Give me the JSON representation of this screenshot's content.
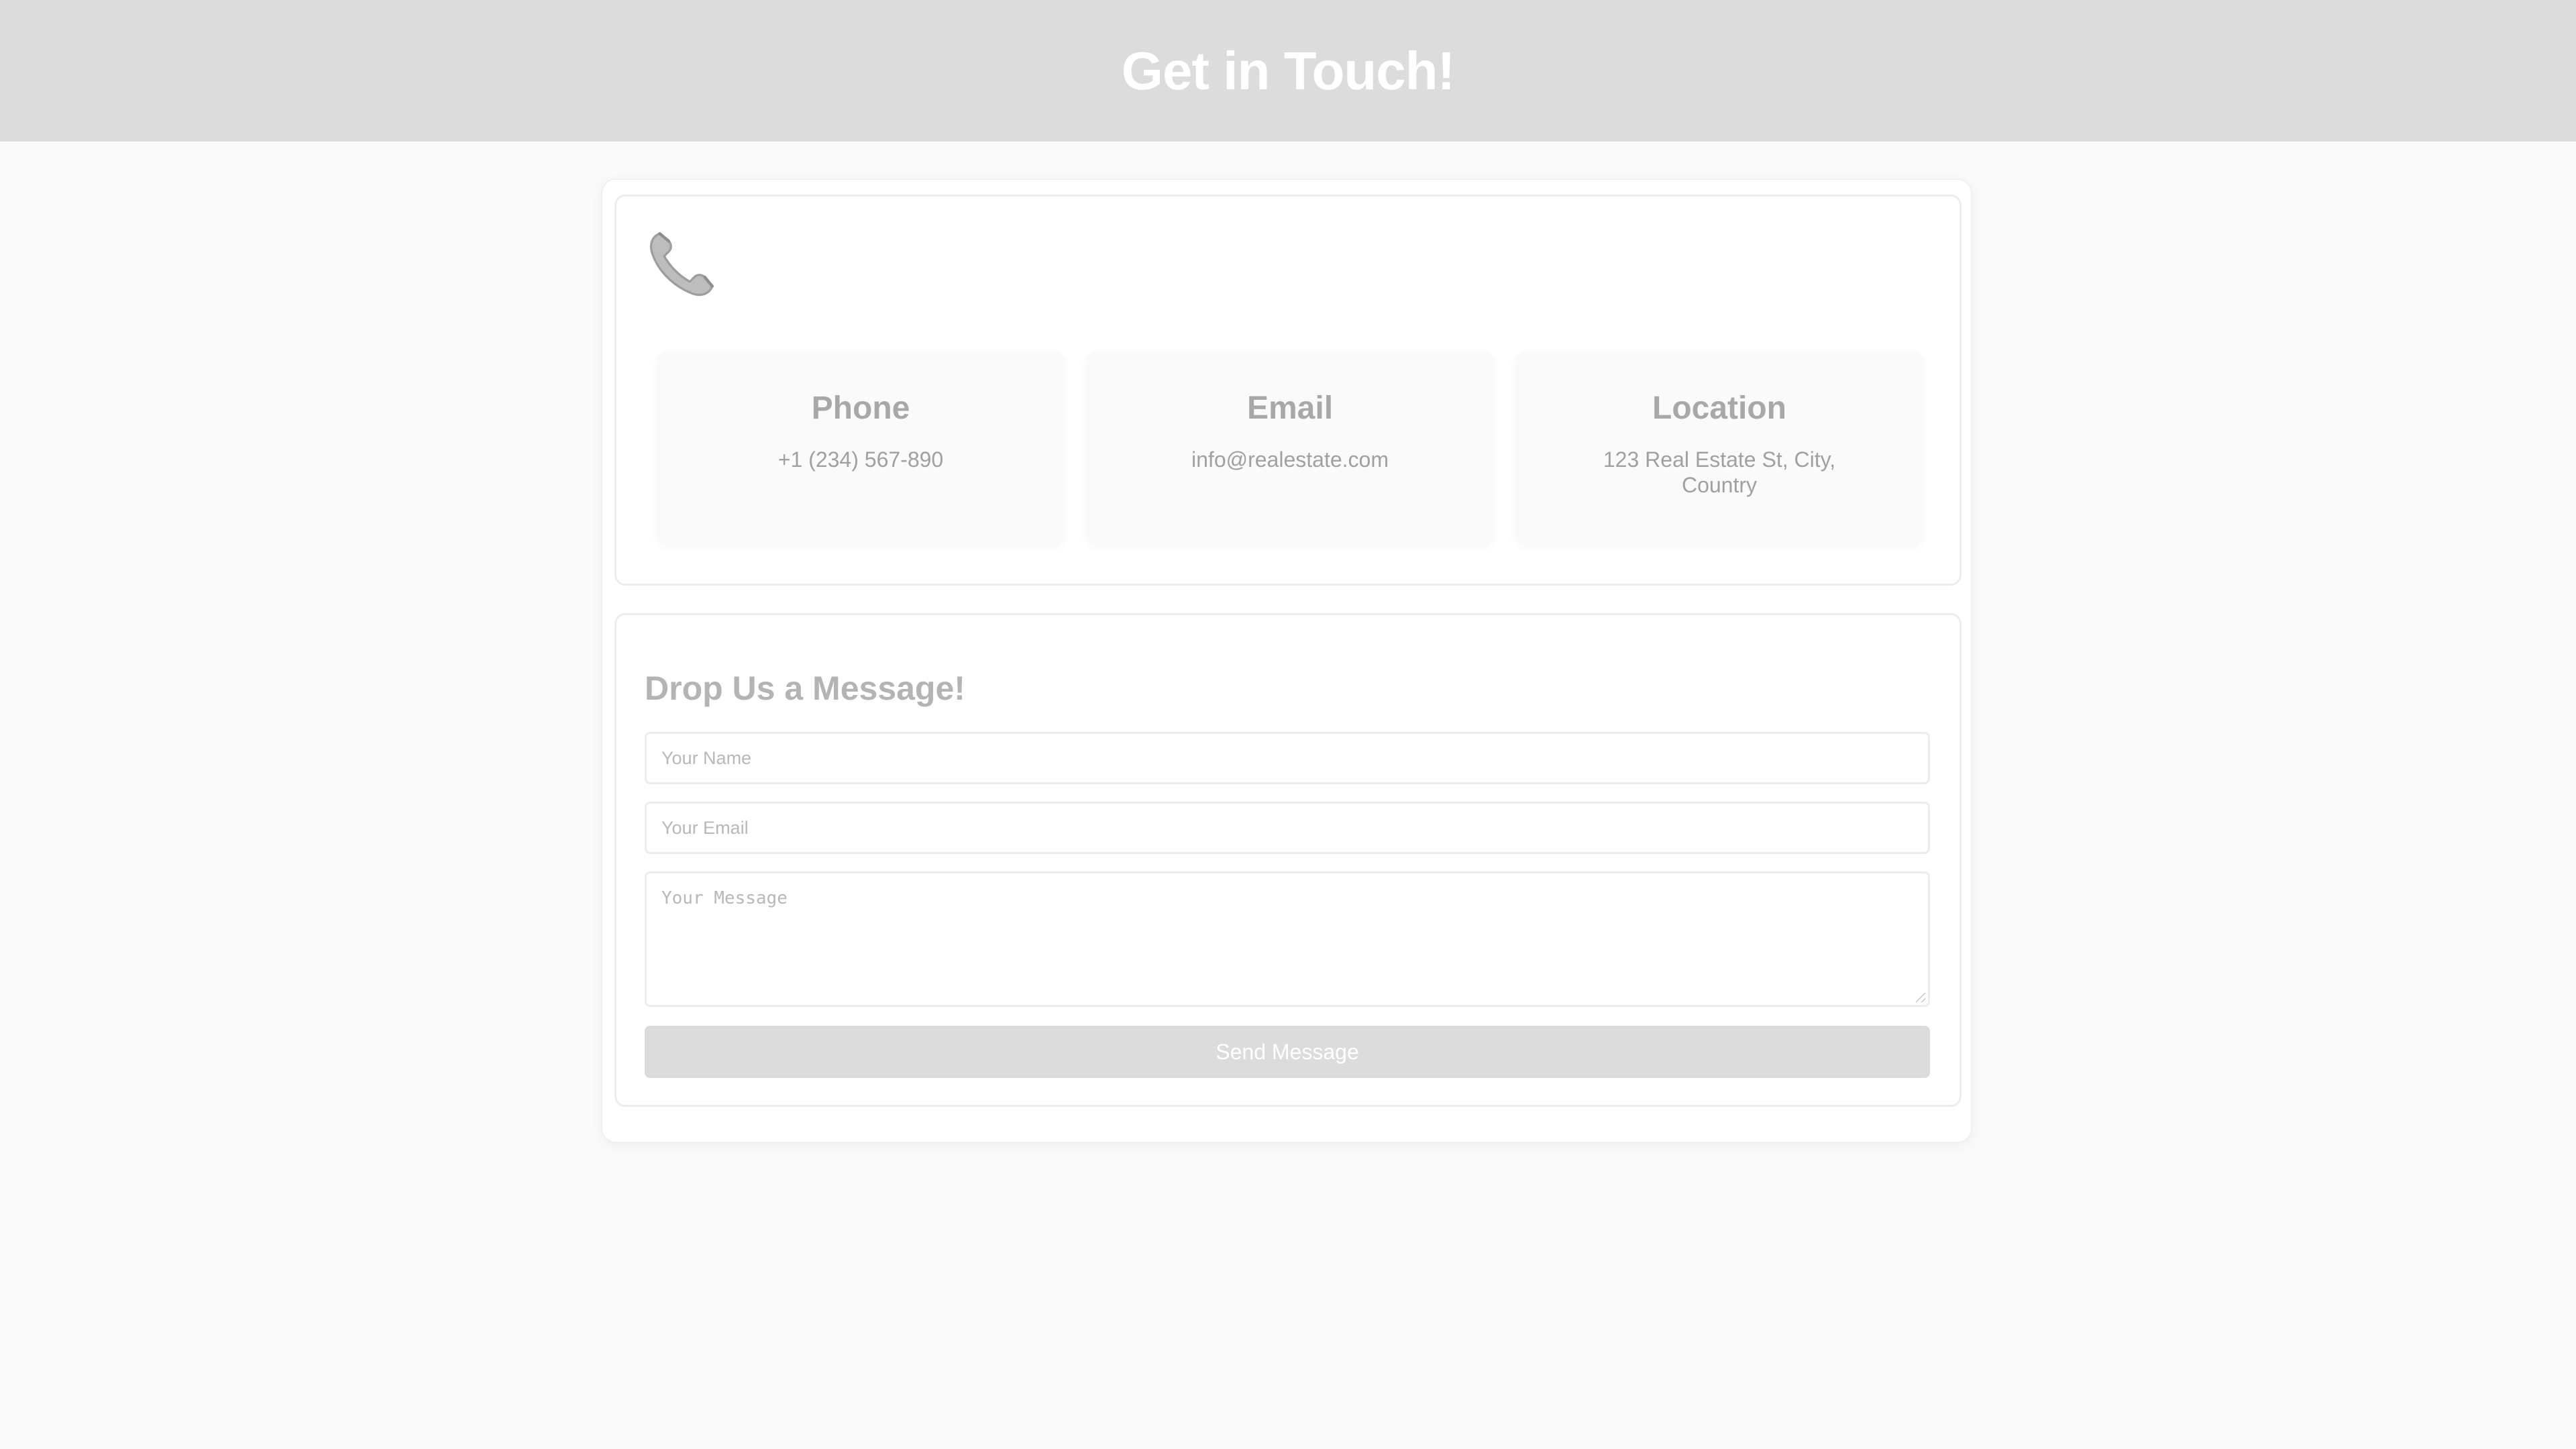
{
  "header": {
    "title": "Get in Touch!"
  },
  "contact_info": {
    "icon": "telephone-receiver-icon",
    "cards": [
      {
        "title": "Phone",
        "text": "+1 (234) 567-890"
      },
      {
        "title": "Email",
        "text": "info@realestate.com"
      },
      {
        "title": "Location",
        "text": "123 Real Estate St, City, Country"
      }
    ]
  },
  "message_form": {
    "title": "Drop Us a Message!",
    "name_placeholder": "Your Name",
    "email_placeholder": "Your Email",
    "message_placeholder": "Your Message",
    "submit_label": "Send Message"
  },
  "colors": {
    "header_background": "#dcdcdc",
    "page_background": "#fafafa",
    "button_background": "#dcdcdc"
  }
}
